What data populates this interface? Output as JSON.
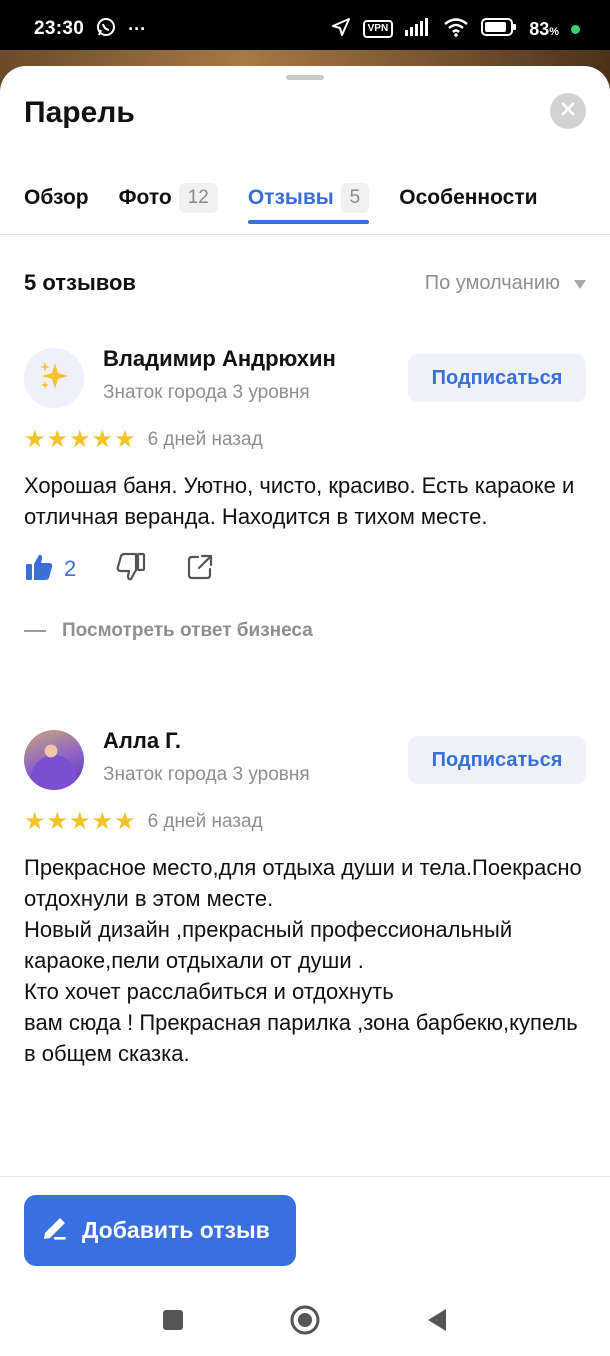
{
  "status_bar": {
    "time": "23:30",
    "overflow": "···",
    "vpn": "VPN",
    "battery_percent": "83",
    "battery_suffix": "%",
    "icons": [
      "whatsapp-icon",
      "location-arrow-icon",
      "vpn-icon",
      "signal-icon",
      "wifi-icon",
      "battery-icon"
    ]
  },
  "sheet": {
    "title": "Парель",
    "tabs": [
      {
        "label": "Обзор",
        "count": null,
        "active": false
      },
      {
        "label": "Фото",
        "count": "12",
        "active": false
      },
      {
        "label": "Отзывы",
        "count": "5",
        "active": true
      },
      {
        "label": "Особенности",
        "count": null,
        "active": false
      }
    ]
  },
  "reviews_header": {
    "count_label": "5 отзывов",
    "sort_label": "По умолчанию"
  },
  "reviews": [
    {
      "author": "Владимир Андрюхин",
      "level": "Знаток города 3 уровня",
      "subscribe_label": "Подписаться",
      "rating": 5,
      "date": "6 дней назад",
      "text": "Хорошая баня. Уютно, чисто, красиво. Есть караоке и отличная веранда. Находится в тихом месте.",
      "likes": "2",
      "business_reply_label": "Посмотреть ответ бизнеса"
    },
    {
      "author": "Алла Г.",
      "level": "Знаток города 3 уровня",
      "subscribe_label": "Подписаться",
      "rating": 5,
      "date": "6 дней назад",
      "text": "Прекрасное место,для отдыха души и тела.Поекрасно отдохнули в этом месте.\nНовый дизайн ,прекрасный профессиональный караоке,пели отдыхали от души .\nКто хочет расслабиться и отдохнуть\nвам сюда ! Прекрасная парилка ,зона барбекю,купель в общем сказка."
    }
  ],
  "footer": {
    "add_review_label": "Добавить отзыв"
  },
  "colors": {
    "accent": "#3a6fd8",
    "button_blue": "#3a6fe0",
    "star": "#f4c229",
    "secondary_text": "#8f8f8f"
  }
}
